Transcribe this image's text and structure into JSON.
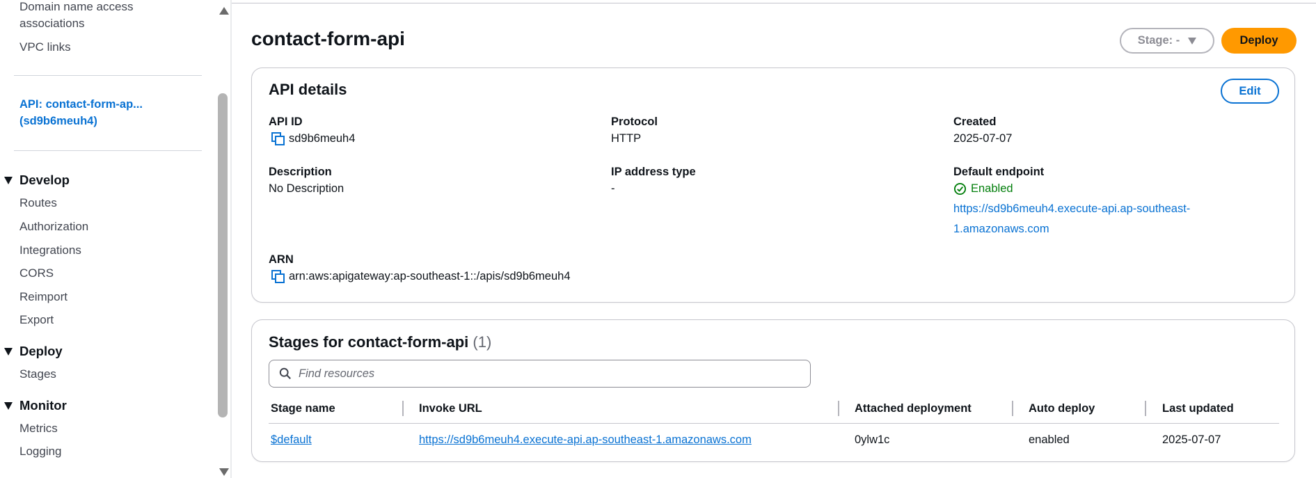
{
  "sidebar": {
    "top_items": [
      {
        "label": "Domain name access associations"
      },
      {
        "label": "VPC links"
      }
    ],
    "api_label": "API: contact-form-ap... (sd9b6meuh4)",
    "sections": [
      {
        "title": "Develop",
        "items": [
          "Routes",
          "Authorization",
          "Integrations",
          "CORS",
          "Reimport",
          "Export"
        ]
      },
      {
        "title": "Deploy",
        "items": [
          "Stages"
        ]
      },
      {
        "title": "Monitor",
        "items": [
          "Metrics",
          "Logging"
        ]
      }
    ]
  },
  "header": {
    "title": "contact-form-api",
    "stage_select": "Stage: -",
    "deploy_label": "Deploy"
  },
  "details": {
    "heading": "API details",
    "edit_label": "Edit",
    "api_id_label": "API ID",
    "api_id": "sd9b6meuh4",
    "protocol_label": "Protocol",
    "protocol": "HTTP",
    "created_label": "Created",
    "created": "2025-07-07",
    "description_label": "Description",
    "description": "No Description",
    "ip_type_label": "IP address type",
    "ip_type": "-",
    "endpoint_label": "Default endpoint",
    "endpoint_status": "Enabled",
    "endpoint_url": "https://sd9b6meuh4.execute-api.ap-southeast-1.amazonaws.com",
    "arn_label": "ARN",
    "arn": "arn:aws:apigateway:ap-southeast-1::/apis/sd9b6meuh4"
  },
  "stages": {
    "heading": "Stages for contact-form-api",
    "count": "(1)",
    "search_placeholder": "Find resources",
    "columns": [
      "Stage name",
      "Invoke URL",
      "Attached deployment",
      "Auto deploy",
      "Last updated"
    ],
    "rows": [
      {
        "stage_name": "$default",
        "invoke_url": "https://sd9b6meuh4.execute-api.ap-southeast-1.amazonaws.com",
        "attached_deployment": "0ylw1c",
        "auto_deploy": "enabled",
        "last_updated": "2025-07-07"
      }
    ]
  },
  "colors": {
    "link": "#0972d3",
    "deploy": "#ff9900",
    "success": "#037f0c"
  }
}
